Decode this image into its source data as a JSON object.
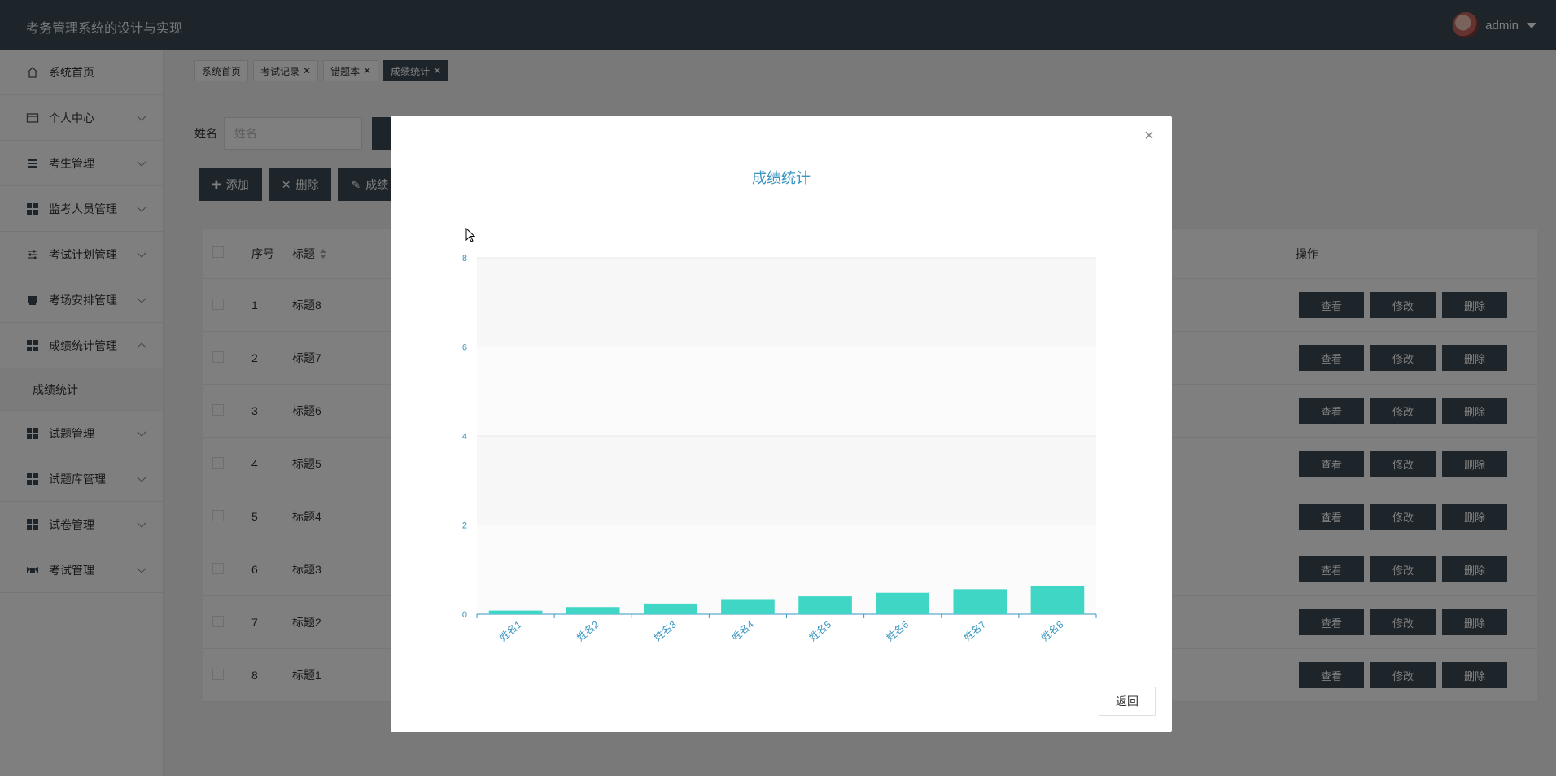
{
  "app": {
    "title": "考务管理系统的设计与实现",
    "user_name": "admin"
  },
  "sidebar": {
    "items": [
      {
        "label": "系统首页",
        "icon": "home-icon",
        "has_chevron": false
      },
      {
        "label": "个人中心",
        "icon": "card-icon",
        "has_chevron": true
      },
      {
        "label": "考生管理",
        "icon": "list-icon",
        "has_chevron": true
      },
      {
        "label": "监考人员管理",
        "icon": "grid-icon",
        "has_chevron": true
      },
      {
        "label": "考试计划管理",
        "icon": "sliders-icon",
        "has_chevron": true
      },
      {
        "label": "考场安排管理",
        "icon": "printer-icon",
        "has_chevron": true
      },
      {
        "label": "成绩统计管理",
        "icon": "grid-icon",
        "has_chevron": true,
        "expanded": true
      },
      {
        "label": "试题管理",
        "icon": "grid-icon",
        "has_chevron": true
      },
      {
        "label": "试题库管理",
        "icon": "grid-icon",
        "has_chevron": true
      },
      {
        "label": "试卷管理",
        "icon": "grid-icon",
        "has_chevron": true
      },
      {
        "label": "考试管理",
        "icon": "flag-icon",
        "has_chevron": true
      }
    ],
    "subitem": "成绩统计"
  },
  "tabs": [
    {
      "label": "系统首页",
      "closable": false,
      "active": false
    },
    {
      "label": "考试记录",
      "closable": true,
      "active": false
    },
    {
      "label": "错题本",
      "closable": true,
      "active": false
    },
    {
      "label": "成绩统计",
      "closable": true,
      "active": true
    }
  ],
  "search": {
    "label": "姓名",
    "placeholder": "姓名"
  },
  "actions": {
    "add": "添加",
    "delete": "删除",
    "stats": "成绩"
  },
  "table": {
    "headers": {
      "index": "序号",
      "title": "标题",
      "ops": "操作"
    },
    "rows": [
      {
        "index": "1",
        "title": "标题8"
      },
      {
        "index": "2",
        "title": "标题7"
      },
      {
        "index": "3",
        "title": "标题6"
      },
      {
        "index": "4",
        "title": "标题5"
      },
      {
        "index": "5",
        "title": "标题4"
      },
      {
        "index": "6",
        "title": "标题3"
      },
      {
        "index": "7",
        "title": "标题2"
      },
      {
        "index": "8",
        "title": "标题1"
      }
    ],
    "row_ops": {
      "view": "查看",
      "edit": "修改",
      "delete": "删除"
    }
  },
  "modal": {
    "close_symbol": "×",
    "back_label": "返回"
  },
  "colors": {
    "accent": "#3d4a55",
    "bar": "#3fd6c6",
    "chart_text": "#3a95c0"
  },
  "chart_data": {
    "type": "bar",
    "title": "成绩统计",
    "categories": [
      "姓名1",
      "姓名2",
      "姓名3",
      "姓名4",
      "姓名5",
      "姓名6",
      "姓名7",
      "姓名8"
    ],
    "values": [
      0.08,
      0.16,
      0.24,
      0.32,
      0.4,
      0.48,
      0.56,
      0.64
    ],
    "ylim": [
      0,
      8
    ],
    "yticks": [
      0,
      2,
      4,
      6,
      8
    ],
    "xlabel": "",
    "ylabel": "",
    "grid": true,
    "legend": "none"
  }
}
